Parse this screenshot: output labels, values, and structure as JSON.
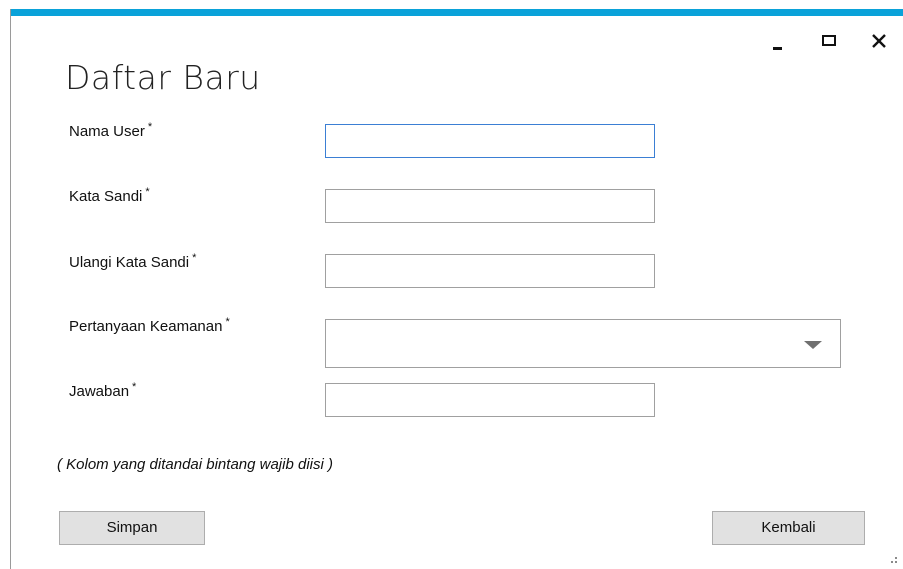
{
  "window": {
    "accent_color": "#0aa2d9",
    "controls": {
      "minimize_icon": "minimize-icon",
      "maximize_icon": "maximize-icon",
      "close_icon": "close-icon"
    }
  },
  "form": {
    "title": "Daftar Baru",
    "fields": {
      "username": {
        "label": "Nama User",
        "required_mark": "*",
        "value": ""
      },
      "password": {
        "label": "Kata Sandi",
        "required_mark": "*",
        "value": ""
      },
      "confirm_password": {
        "label": "Ulangi Kata Sandi",
        "required_mark": "*",
        "value": ""
      },
      "security_question": {
        "label": "Pertanyaan Keamanan",
        "required_mark": "*",
        "selected": ""
      },
      "answer": {
        "label": "Jawaban",
        "required_mark": "*",
        "value": ""
      }
    },
    "note": "( Kolom yang ditandai bintang wajib diisi )",
    "buttons": {
      "save": "Simpan",
      "back": "Kembali"
    }
  }
}
